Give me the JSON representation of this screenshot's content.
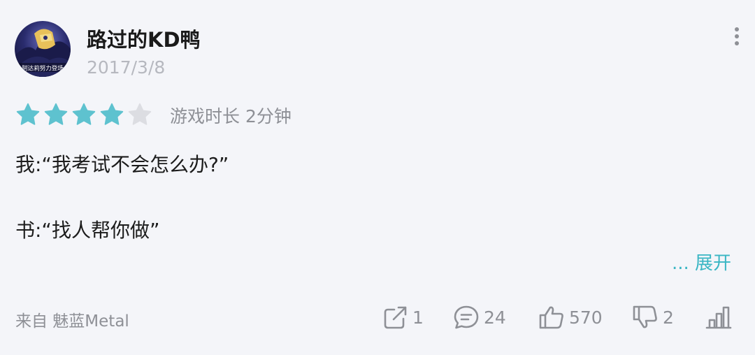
{
  "review": {
    "username": "路过的KD鸭",
    "date": "2017/3/8",
    "avatar_text": "阿达莉努力登场",
    "rating": 4,
    "rating_max": 5,
    "playtime": "游戏时长 2分钟",
    "lines": [
      "我:“我考试不会怎么办?”",
      "书:“找人帮你做”"
    ],
    "expand_label": "... 展开",
    "device": "来自 魅蓝Metal"
  },
  "actions": {
    "share_count": "1",
    "comment_count": "24",
    "like_count": "570",
    "dislike_count": "2"
  },
  "icons": {
    "more": "more-vertical-icon",
    "share": "share-icon",
    "comment": "comment-icon",
    "like": "thumbs-up-icon",
    "dislike": "thumbs-down-icon",
    "stats": "bar-chart-icon"
  },
  "colors": {
    "star_filled": "#5ec2cf",
    "star_empty": "#dcdde2",
    "accent": "#3ab6c4",
    "muted_text": "#8e9096",
    "background": "#f4f5f9"
  }
}
